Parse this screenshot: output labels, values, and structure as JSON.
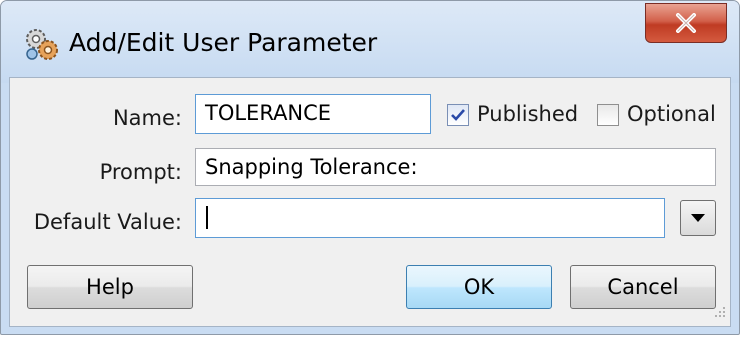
{
  "window": {
    "title": "Add/Edit User Parameter",
    "app_icon": "gears-icon",
    "close_icon": "close-x-icon"
  },
  "form": {
    "name": {
      "label": "Name:",
      "value": "TOLERANCE"
    },
    "published": {
      "label": "Published",
      "checked": true
    },
    "optional": {
      "label": "Optional",
      "checked": false
    },
    "prompt": {
      "label": "Prompt:",
      "value": "Snapping Tolerance:"
    },
    "default_value": {
      "label": "Default Value:",
      "value": "",
      "dropdown_icon": "triangle-down-icon"
    }
  },
  "buttons": {
    "help": "Help",
    "ok": "OK",
    "cancel": "Cancel"
  },
  "colors": {
    "title_bar": "#c9dcf2",
    "close_button": "#c8472e",
    "default_button": "#bee6fd",
    "client_bg": "#f0f0f0"
  }
}
